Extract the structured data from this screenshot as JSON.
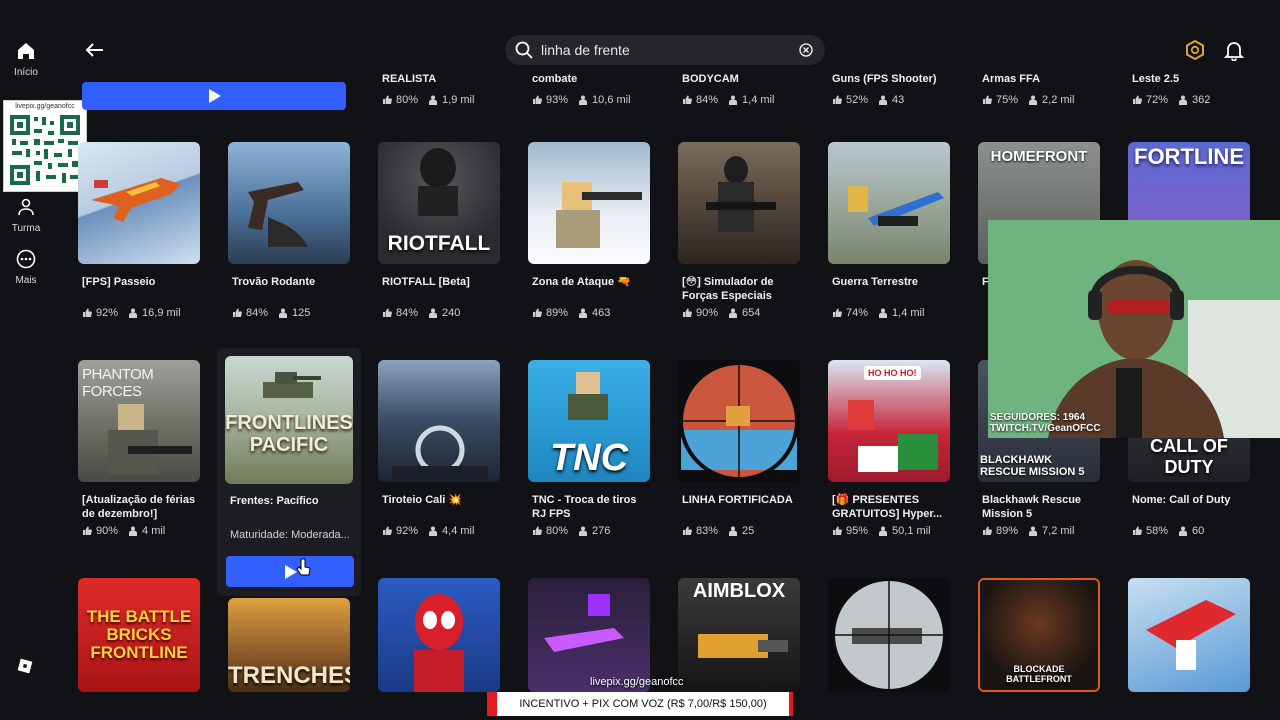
{
  "search": {
    "value": "linha de frente"
  },
  "nav": {
    "home_label": "Início",
    "party_label": "Turma",
    "more_label": "Mais"
  },
  "qr": {
    "label": "livepix.gg/geanofcc"
  },
  "row0": [
    {
      "title": "",
      "rating": "",
      "players": ""
    },
    {
      "title": "REALISTA",
      "rating": "80%",
      "players": "1,9 mil"
    },
    {
      "title": "combate",
      "rating": "93%",
      "players": "10,6 mil"
    },
    {
      "title": "BODYCAM",
      "rating": "84%",
      "players": "1,4 mil"
    },
    {
      "title": "Guns (FPS Shooter)",
      "rating": "52%",
      "players": "43"
    },
    {
      "title": "Armas FFA",
      "rating": "75%",
      "players": "2,2 mil"
    },
    {
      "title": "Leste 2.5",
      "rating": "72%",
      "players": "362"
    }
  ],
  "row1": [
    {
      "title": "[FPS] Passeio",
      "rating": "92%",
      "players": "16,9 mil",
      "thumb_text": "",
      "color": "#c6d9ea"
    },
    {
      "title": "Trovão Rodante",
      "rating": "84%",
      "players": "125",
      "thumb_text": "",
      "color": "#5a7fa6"
    },
    {
      "title": "RIOTFALL [Beta]",
      "rating": "84%",
      "players": "240",
      "thumb_text": "RIOTFALL",
      "color": "#3c3d40"
    },
    {
      "title": "Zona de Ataque 🔫",
      "rating": "89%",
      "players": "463",
      "thumb_text": "",
      "color": "#b9c9d8"
    },
    {
      "title": "[😳] Simulador de Forças Especiais",
      "rating": "90%",
      "players": "654",
      "thumb_text": "",
      "color": "#4d4a45"
    },
    {
      "title": "Guerra Terrestre",
      "rating": "74%",
      "players": "1,4 mil",
      "thumb_text": "",
      "color": "#a4b3a6"
    },
    {
      "title": "F",
      "rating": "",
      "players": "",
      "thumb_text": "HOMEFRONT",
      "color": "#6a7068"
    },
    {
      "title": "",
      "rating": "",
      "players": "",
      "thumb_text": "FORTLINE",
      "color": "#4b58b8"
    }
  ],
  "row2": [
    {
      "title": "[Atualização de férias de dezembro!]",
      "rating": "90%",
      "players": "4 mil",
      "thumb_text": "PHANTOM FORCES",
      "color": "#6b6b63"
    },
    {
      "title": "Tiroteio Cali 💥",
      "rating": "92%",
      "players": "4,4 mil",
      "thumb_text": "",
      "color": "#2d3c52"
    },
    {
      "title": "TNC - Troca de tiros RJ FPS",
      "rating": "80%",
      "players": "276",
      "thumb_text": "TNC",
      "color": "#1f8fc9"
    },
    {
      "title": "LINHA FORTIFICADA",
      "rating": "83%",
      "players": "25",
      "thumb_text": "",
      "color": "#d35a3d"
    },
    {
      "title": "[🎁 PRESENTES GRATUITOS] Hyper...",
      "rating": "95%",
      "players": "50,1 mil",
      "thumb_text": "HO HO HO!",
      "color": "#c7263a"
    },
    {
      "title": "Blackhawk Rescue Mission 5",
      "rating": "89%",
      "players": "7,2 mil",
      "thumb_text": "BLACKHAWK RESCUE MISSION 5",
      "color": "#343a45"
    },
    {
      "title": "Nome: Call of Duty",
      "rating": "58%",
      "players": "60",
      "thumb_text": "CALL OF DUTY",
      "color": "#2a2c30"
    }
  ],
  "hover_card": {
    "title": "Frentes: Pacífico",
    "maturity": "Maturidade: Moderada...",
    "thumb_text": "FRONTLINES PACIFIC"
  },
  "row3": [
    {
      "thumb_text": "THE BATTLE BRICKS FRONTLINE",
      "color": "#c41e1e"
    },
    {
      "thumb_text": "TRENCHES",
      "color": "#8a5a2a"
    },
    {
      "thumb_text": "",
      "color": "#2c5bc2"
    },
    {
      "thumb_text": "",
      "color": "#2a1f3a"
    },
    {
      "thumb_text": "AIMBLOX",
      "color": "#1c1c1c"
    },
    {
      "thumb_text": "",
      "color": "#9aa0a2"
    },
    {
      "thumb_text": "BLOCKADE BATTLEFRONT",
      "color": "#1a1412"
    },
    {
      "thumb_text": "",
      "color": "#c7dff0"
    }
  ],
  "webcam": {
    "followers": "SEGUIDORES: 1964",
    "twitch": "TWITCH.TV/GeanOFCC"
  },
  "watermark": "livepix.gg/geanofcc",
  "banner": "INCENTIVO + PIX COM VOZ (R$ 7,00/R$ 150,00)",
  "colors": {
    "accent_blue": "#335fff",
    "background": "#111216",
    "banner_red": "#e01b24"
  }
}
